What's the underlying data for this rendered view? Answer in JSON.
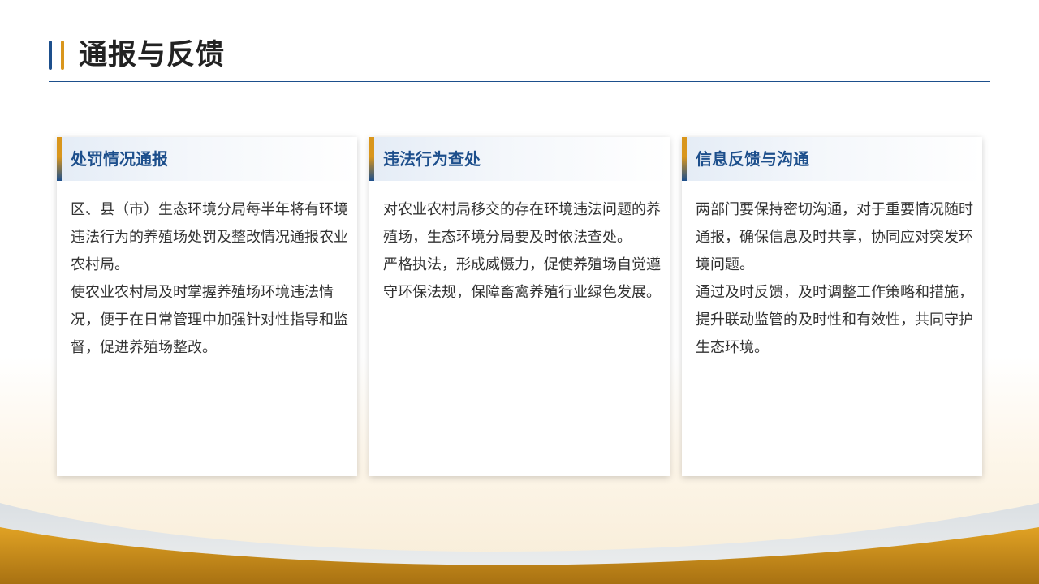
{
  "header": {
    "title": "通报与反馈"
  },
  "cards": [
    {
      "title": "处罚情况通报",
      "paragraphs": [
        "区、县（市）生态环境分局每半年将有环境违法行为的养殖场处罚及整改情况通报农业农村局。",
        "使农业农村局及时掌握养殖场环境违法情况，便于在日常管理中加强针对性指导和监督，促进养殖场整改。"
      ]
    },
    {
      "title": "违法行为查处",
      "paragraphs": [
        "对农业农村局移交的存在环境违法问题的养殖场，生态环境分局要及时依法查处。",
        "严格执法，形成威慑力，促使养殖场自觉遵守环保法规，保障畜禽养殖行业绿色发展。"
      ]
    },
    {
      "title": "信息反馈与沟通",
      "paragraphs": [
        "两部门要保持密切沟通，对于重要情况随时通报，确保信息及时共享，协同应对突发环境问题。",
        "通过及时反馈，及时调整工作策略和措施，提升联动监管的及时性和有效性，共同守护生态环境。"
      ]
    }
  ],
  "colors": {
    "primary_blue": "#1d4f8c",
    "accent_gold": "#d9961c"
  }
}
